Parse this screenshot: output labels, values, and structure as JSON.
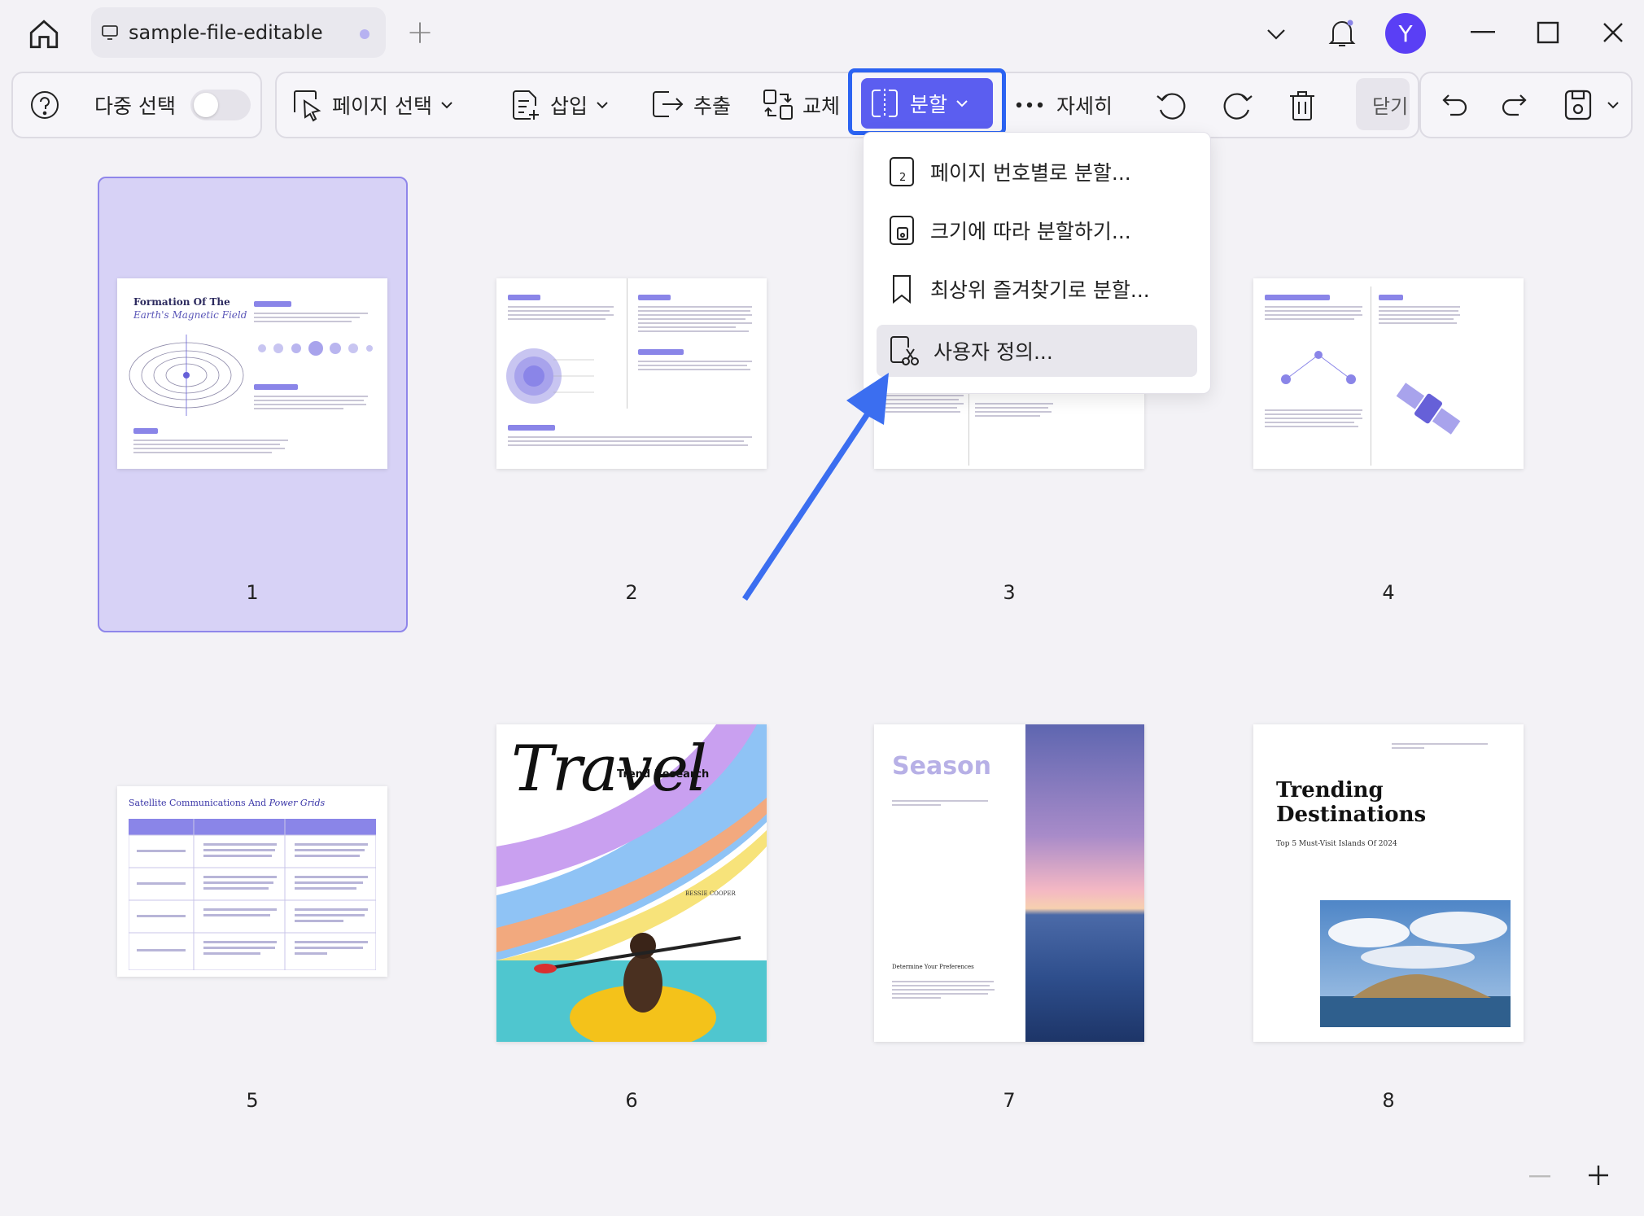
{
  "titlebar": {
    "tab_title": "sample-file-editable",
    "new_tab": "+",
    "avatar_letter": "Y"
  },
  "toolbar": {
    "multi_select_label": "다중 선택",
    "page_select_label": "페이지 선택",
    "insert_label": "삽입",
    "extract_label": "추출",
    "replace_label": "교체",
    "split_label": "분할",
    "more_label": "자세히",
    "close_label": "닫기"
  },
  "split_menu": {
    "items": [
      {
        "label": "페이지 번호별로 분할...",
        "icon": "page-number-icon"
      },
      {
        "label": "크기에 따라 분할하기...",
        "icon": "file-size-icon"
      },
      {
        "label": "최상위 즐겨찾기로 분할...",
        "icon": "bookmark-icon"
      },
      {
        "label": "사용자 정의...",
        "icon": "scissors-icon"
      }
    ]
  },
  "pages": [
    {
      "number": "1",
      "title_a": "Formation Of The",
      "title_b": "Earth's Magnetic Field"
    },
    {
      "number": "2"
    },
    {
      "number": "3"
    },
    {
      "number": "4"
    },
    {
      "number": "5",
      "title_a": "Satellite Communications And",
      "title_b": "Power Grids"
    },
    {
      "number": "6",
      "script": "Travel",
      "subtitle": "Trend Research",
      "author": "BESSIE COOPER"
    },
    {
      "number": "7",
      "title": "Season",
      "heading": "Determine Your Preferences"
    },
    {
      "number": "8",
      "title_a": "Trending",
      "title_b": "Destinations",
      "subtitle": "Top 5 Must-Visit Islands Of 2024"
    }
  ],
  "colors": {
    "accent": "#5b5ef0",
    "highlight": "#2b63f2",
    "selection": "#d7d2f6",
    "avatar": "#5a3ff5"
  }
}
